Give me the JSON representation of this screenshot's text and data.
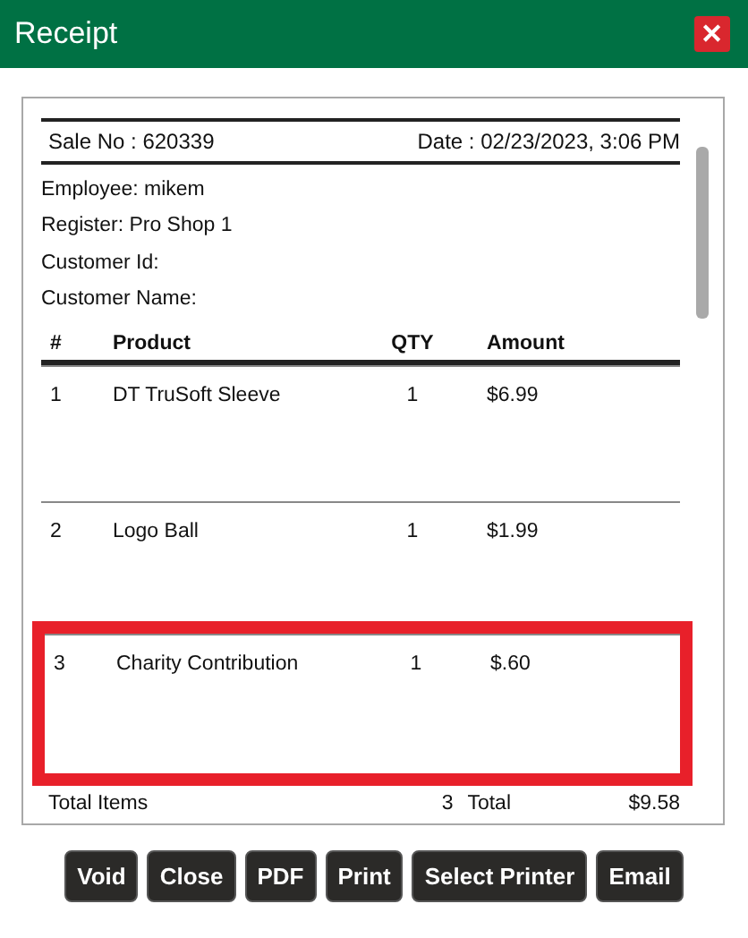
{
  "window": {
    "title": "Receipt",
    "close_label": "✕"
  },
  "receipt": {
    "sale_no": "Sale No : 620339",
    "date": "Date : 02/23/2023, 3:06 PM",
    "info": [
      "Employee: mikem",
      "Register: Pro Shop 1",
      "Customer Id:",
      "Customer Name:"
    ],
    "columns": [
      "#",
      "Product",
      "QTY",
      "Amount"
    ],
    "rows": [
      {
        "num": "1",
        "product": "DT TruSoft Sleeve",
        "qty": "1",
        "amount": "$6.99",
        "highlighted": false
      },
      {
        "num": "2",
        "product": "Logo Ball",
        "qty": "1",
        "amount": "$1.99",
        "highlighted": false
      },
      {
        "num": "3",
        "product": "Charity Contribution",
        "qty": "1",
        "amount": "$.60",
        "highlighted": true
      }
    ],
    "totals": {
      "items_label": "Total Items",
      "items": "3",
      "total_label": "Total",
      "total": "$9.58"
    }
  },
  "buttons": [
    "Void",
    "Close",
    "PDF",
    "Print",
    "Select Printer",
    "Email"
  ]
}
